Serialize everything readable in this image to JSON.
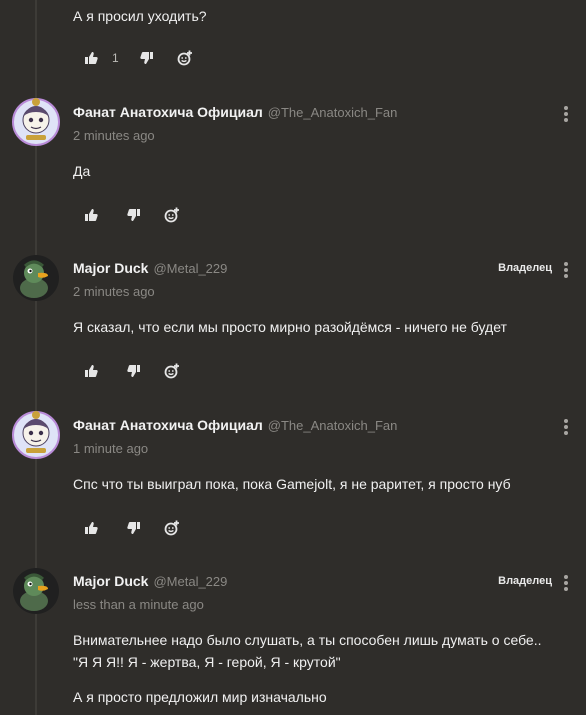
{
  "top_comment": {
    "text": "А я просил уходить?",
    "like_count": "1"
  },
  "comments": [
    {
      "author": "Фанат Анатохича Официал",
      "handle": "@The_Anatoxich_Fan",
      "time": "2 minutes ago",
      "text": "Да",
      "owner_badge": "",
      "avatar_icon": "fan-avatar"
    },
    {
      "author": "Major Duck",
      "handle": "@Metal_229",
      "time": "2 minutes ago",
      "text": "Я сказал, что если мы просто мирно разойдёмся - ничего не будет",
      "owner_badge": "Владелец",
      "avatar_icon": "duck-avatar"
    },
    {
      "author": "Фанат Анатохича Официал",
      "handle": "@The_Anatoxich_Fan",
      "time": "1 minute ago",
      "text": "Спс что ты выиграл пока, пока Gamejolt, я не раритет, я просто нуб",
      "owner_badge": "",
      "avatar_icon": "fan-avatar"
    },
    {
      "author": "Major Duck",
      "handle": "@Metal_229",
      "time": "less than a minute ago",
      "text": "Внимательнее надо было слушать, а ты способен лишь думать о себе.. \"Я Я Я!! Я - жертва, Я - герой, Я - крутой\"",
      "text2": "А я просто предложил мир изначально",
      "owner_badge": "Владелец",
      "avatar_icon": "duck-avatar"
    }
  ],
  "colors": {
    "background": "#2f2d2a",
    "muted": "#8a8884",
    "text": "#f0f0f0"
  }
}
